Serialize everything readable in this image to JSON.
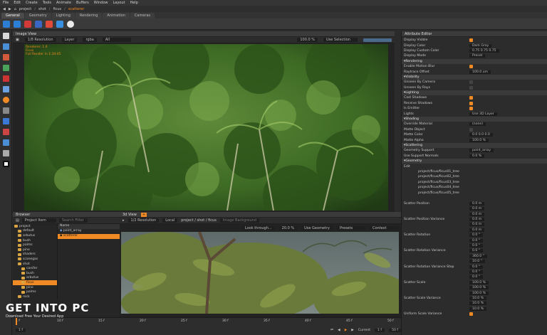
{
  "menu": [
    "File",
    "Edit",
    "Create",
    "Tools",
    "Animate",
    "Buffers",
    "Window",
    "Layout",
    "Help"
  ],
  "path": {
    "root": "project",
    "shot": "shot",
    "item": "ficus",
    "current": "scatterer"
  },
  "shelf_tabs": [
    "General",
    "Geometry",
    "Lighting",
    "Rendering",
    "Animation",
    "Cameras"
  ],
  "image_view": {
    "title": "Image View",
    "resolution": "1/8 Resolution",
    "layer": "Layer",
    "channels": "rgba",
    "all": "All",
    "zoom": "100.0 %",
    "selection": "Use Selection",
    "overlay": [
      "Renderer: 1.6",
      "Ficus",
      "Full Render in 1:34:45"
    ]
  },
  "browser": {
    "title": "Browser",
    "project_item": "Project Item",
    "search": "Search Filter",
    "col_name": "Name",
    "items": [
      "point_array",
      "scatterer"
    ],
    "tree": [
      "project",
      "default",
      "arbutus",
      "bush",
      "palms",
      "pine",
      "shaders",
      "scanegas",
      "shot",
      "conifer",
      "bush",
      "arbutus",
      "ficus",
      "pine",
      "palms",
      "rock"
    ]
  },
  "view3d": {
    "title": "3d View",
    "resolution": "1/2 Resolution",
    "mode": "Local",
    "path": "project / shot / ficus",
    "bg": "Image Background",
    "look": "Look through...",
    "zoom": "20.0 %",
    "geom": "Use Geometry",
    "preset": "Presets",
    "context": "Context"
  },
  "timeline": {
    "ticks": [
      "1 f",
      "10 f",
      "15 f",
      "20 f",
      "25 f",
      "30 f",
      "35 f",
      "40 f",
      "45 f",
      "50 f"
    ],
    "start": "1 f",
    "end": "50 f",
    "current_label": "Current",
    "current": "1 f"
  },
  "attr": {
    "title": "Attribute Editor",
    "rows": [
      {
        "t": "row",
        "l": "Display Visible",
        "c": true
      },
      {
        "t": "row",
        "l": "Display Color",
        "v": "Dark Gray"
      },
      {
        "t": "row",
        "l": "Display Custom Color",
        "v": "0.75   0.75   0.75"
      },
      {
        "t": "row",
        "l": "Display Mode",
        "v": "Preset"
      },
      {
        "t": "sec",
        "l": "Rendering"
      },
      {
        "t": "row",
        "l": "Enable Motion Blur",
        "c": true
      },
      {
        "t": "row",
        "l": "Raytrace Offset",
        "v": "100.0 um"
      },
      {
        "t": "sec",
        "l": "Visibility"
      },
      {
        "t": "row",
        "l": "Unseen By Camera",
        "c": false
      },
      {
        "t": "row",
        "l": "Unseen By Rays",
        "c": false
      },
      {
        "t": "sec",
        "l": "Lighting"
      },
      {
        "t": "row",
        "l": "Cast Shadows",
        "c": true
      },
      {
        "t": "row",
        "l": "Receive Shadows",
        "c": true
      },
      {
        "t": "row",
        "l": "Is Emitter",
        "c": true
      },
      {
        "t": "row",
        "l": "Lights",
        "v": "Use 3D Layer"
      },
      {
        "t": "sec",
        "l": "Shading"
      },
      {
        "t": "row",
        "l": "Override Material",
        "v": "(none)"
      },
      {
        "t": "row",
        "l": "Matte Object",
        "c": false
      },
      {
        "t": "row",
        "l": "Matte Color",
        "v": "0.0   0.0   0.0"
      },
      {
        "t": "row",
        "l": "Matte Alpha",
        "v": "100.0 %"
      },
      {
        "t": "sec",
        "l": "Scattering"
      },
      {
        "t": "row",
        "l": "Geometry Support",
        "v": "point_array"
      },
      {
        "t": "row",
        "l": "Use Support Normals",
        "v": "0.0 %"
      },
      {
        "t": "sec",
        "l": "Geometry"
      },
      {
        "t": "row",
        "l": "Edit",
        "v": ""
      },
      {
        "t": "file",
        "l": "project/ficus/ficus01_tree"
      },
      {
        "t": "file",
        "l": "project/ficus/ficus02_tree"
      },
      {
        "t": "file",
        "l": "project/ficus/ficus03_tree"
      },
      {
        "t": "file",
        "l": "project/ficus/ficus04_tree"
      },
      {
        "t": "file",
        "l": "project/ficus/ficus05_tree"
      },
      {
        "t": "gap"
      },
      {
        "t": "row",
        "l": "Scatter Position",
        "v": "0.0 m"
      },
      {
        "t": "row",
        "l": "",
        "v": "0.0 m"
      },
      {
        "t": "row",
        "l": "",
        "v": "0.0 m"
      },
      {
        "t": "row",
        "l": "Scatter Position Variance",
        "v": "0.0 m"
      },
      {
        "t": "row",
        "l": "",
        "v": "0.0 m"
      },
      {
        "t": "row",
        "l": "",
        "v": "0.0 m"
      },
      {
        "t": "row",
        "l": "Scatter Rotation",
        "v": "0.0 °"
      },
      {
        "t": "row",
        "l": "",
        "v": "0.0 °"
      },
      {
        "t": "row",
        "l": "",
        "v": "0.0 °"
      },
      {
        "t": "row",
        "l": "Scatter Rotation Variance",
        "v": "0.0 °"
      },
      {
        "t": "row",
        "l": "",
        "v": "360.0 °"
      },
      {
        "t": "row",
        "l": "",
        "v": "10.0 °"
      },
      {
        "t": "row",
        "l": "Scatter Rotation Variance Step",
        "v": "0.0 °"
      },
      {
        "t": "row",
        "l": "",
        "v": "0.0 °"
      },
      {
        "t": "row",
        "l": "",
        "v": "0.0 °"
      },
      {
        "t": "row",
        "l": "Scatter Scale",
        "v": "100.0 %"
      },
      {
        "t": "row",
        "l": "",
        "v": "100.0 %"
      },
      {
        "t": "row",
        "l": "",
        "v": "100.0 %"
      },
      {
        "t": "row",
        "l": "Scatter Scale Variance",
        "v": "10.0 %"
      },
      {
        "t": "row",
        "l": "",
        "v": "10.0 %"
      },
      {
        "t": "row",
        "l": "",
        "v": "10.0 %"
      },
      {
        "t": "row",
        "l": "Uniform Scale Variance",
        "c": true
      }
    ]
  },
  "watermark": {
    "brand_a": "GET ",
    "brand_b": "INTO ",
    "brand_c": "PC",
    "tagline": "Download Free Your Desired App"
  }
}
